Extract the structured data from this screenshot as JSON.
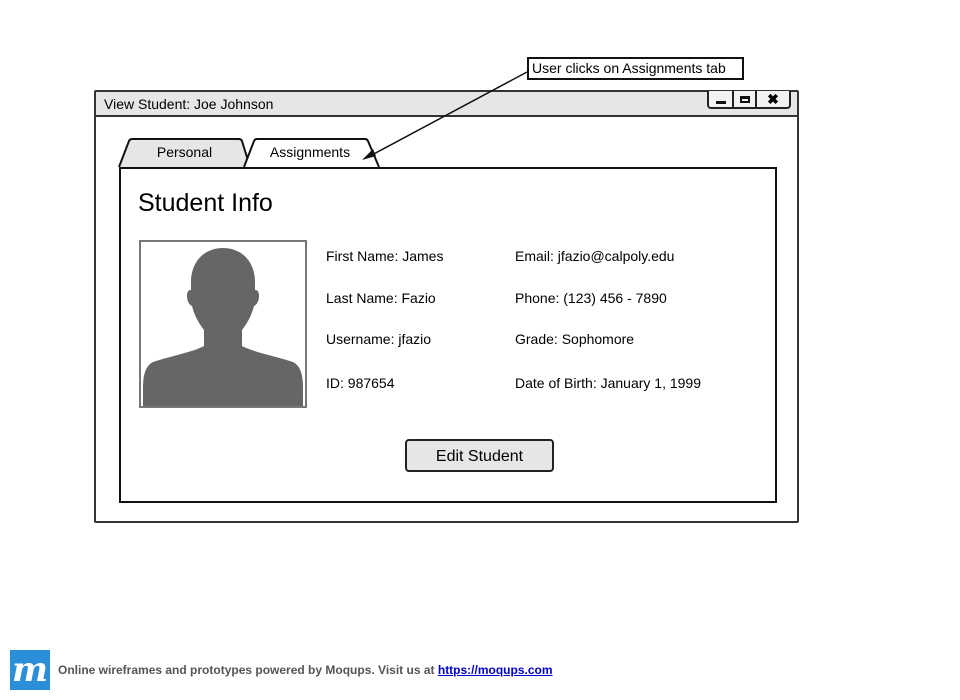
{
  "window": {
    "title": "View Student: Joe Johnson",
    "controls": {
      "minimize_icon": "minimize-icon",
      "maximize_icon": "maximize-icon",
      "close_label": "✖"
    }
  },
  "tabs": [
    {
      "label": "Personal",
      "active": true
    },
    {
      "label": "Assignments",
      "active": false
    }
  ],
  "callout": {
    "text": "User clicks on Assignments tab"
  },
  "panel": {
    "title": "Student Info",
    "avatar_icon": "person-silhouette-icon",
    "fields": {
      "first_name": "First Name: James",
      "last_name": "Last Name: Fazio",
      "username": "Username: jfazio",
      "id": "ID: 987654",
      "email": "Email: jfazio@calpoly.edu",
      "phone": "Phone: (123) 456 - 7890",
      "grade": "Grade: Sophomore",
      "dob": "Date of Birth: January 1, 1999"
    },
    "edit_button_label": "Edit Student"
  },
  "footer": {
    "logo_letter": "m",
    "text": "Online wireframes and prototypes powered by Moqups. Visit us at ",
    "link_text": "https://moqups.com"
  },
  "colors": {
    "titlebar_bg": "#e6e6e6",
    "avatar_silhouette": "#666666",
    "logo_bg": "#2a8fd8",
    "link": "#0000cc"
  }
}
